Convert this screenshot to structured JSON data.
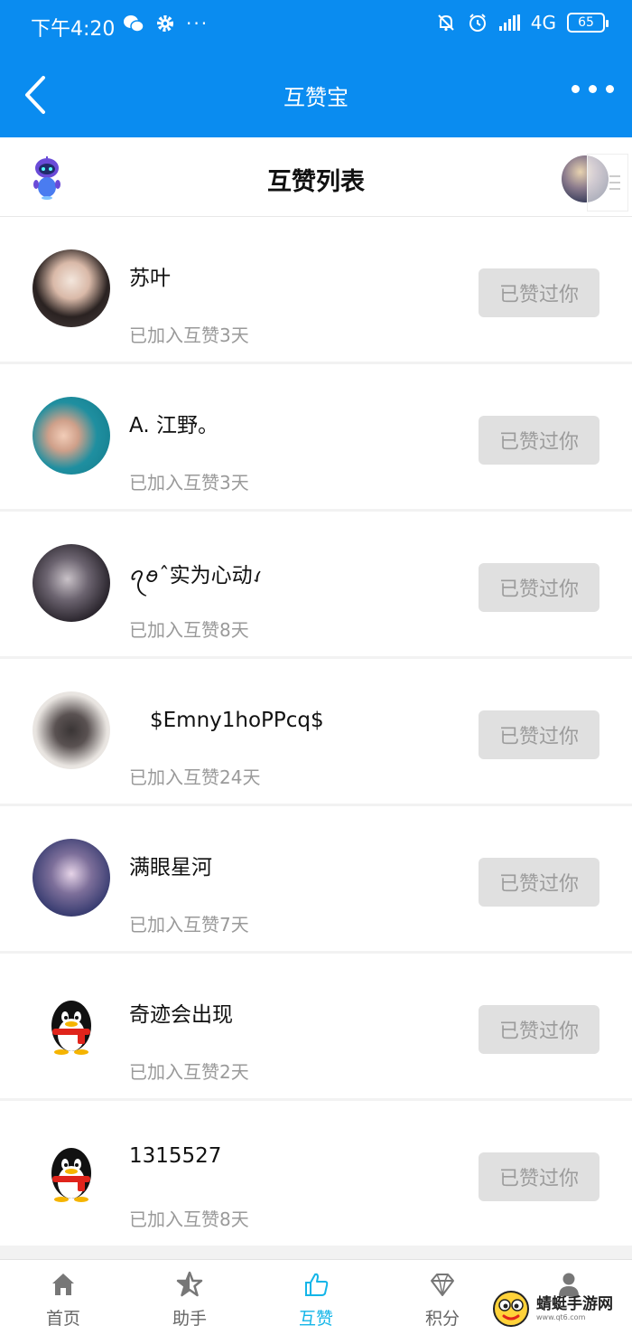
{
  "status_bar": {
    "time": "下午4:20",
    "network": "4G",
    "battery": "65"
  },
  "nav": {
    "title": "互赞宝"
  },
  "sub_header": {
    "title": "互赞列表"
  },
  "users": [
    {
      "name": "苏叶",
      "joined": "已加入互赞3天",
      "button": "已赞过你"
    },
    {
      "name": "A. 江野。",
      "joined": "已加入互赞3天",
      "button": "已赞过你"
    },
    {
      "name": "ꪖꪮˆ实为心动ꪹ",
      "joined": "已加入互赞8天",
      "button": "已赞过你"
    },
    {
      "name": "　$Emny1hoPPcq$",
      "joined": "已加入互赞24天",
      "button": "已赞过你"
    },
    {
      "name": "满眼星河",
      "joined": "已加入互赞7天",
      "button": "已赞过你"
    },
    {
      "name": "奇迹会出现",
      "joined": "已加入互赞2天",
      "button": "已赞过你"
    },
    {
      "name": "1315527",
      "joined": "已加入互赞8天",
      "button": "已赞过你"
    }
  ],
  "tabs": [
    {
      "label": "首页",
      "icon": "home-icon"
    },
    {
      "label": "助手",
      "icon": "star-icon"
    },
    {
      "label": "互赞",
      "icon": "thumbs-up-icon",
      "active": true
    },
    {
      "label": "积分",
      "icon": "diamond-icon"
    },
    {
      "label": "我的",
      "icon": "person-icon"
    }
  ],
  "watermark": {
    "text": "蜻蜓手游网",
    "sub": "www.qt6.com"
  },
  "colors": {
    "primary": "#0a8cf0",
    "tab_active": "#13b5e8",
    "button_bg": "#e0e0e0"
  }
}
